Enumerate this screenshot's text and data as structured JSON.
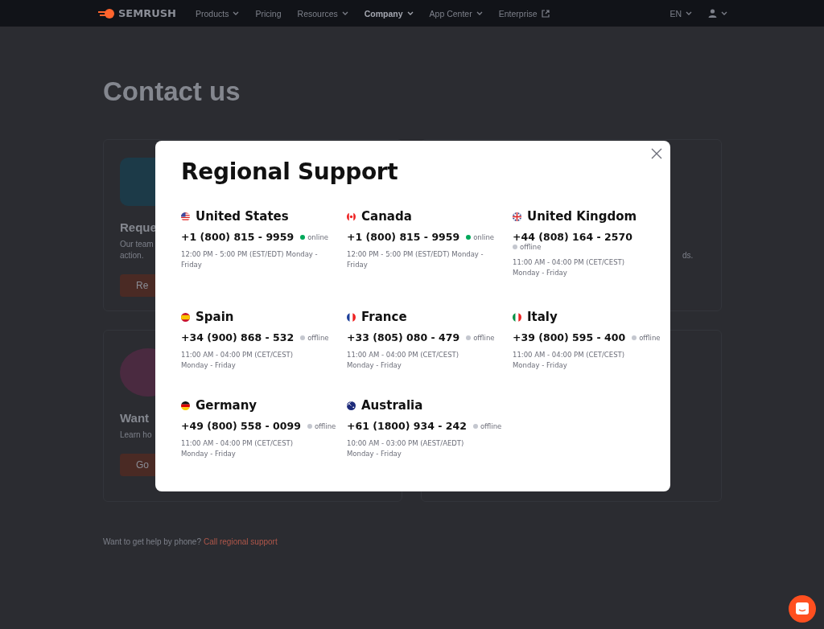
{
  "nav": {
    "logo": "SEMRUSH",
    "items": [
      {
        "label": "Products",
        "selected": false,
        "kind": "menu"
      },
      {
        "label": "Pricing",
        "selected": false,
        "kind": "link"
      },
      {
        "label": "Resources",
        "selected": false,
        "kind": "menu"
      },
      {
        "label": "Company",
        "selected": true,
        "kind": "menu"
      },
      {
        "label": "App Center",
        "selected": false,
        "kind": "menu"
      },
      {
        "label": "Enterprise",
        "selected": false,
        "kind": "external"
      }
    ],
    "language": "EN"
  },
  "page": {
    "title": "Contact us",
    "cards": [
      {
        "heading": "Reque",
        "text": [
          "Our team",
          "action."
        ],
        "button": "Re"
      },
      {
        "heading": "Want",
        "text": [
          "Learn ho"
        ],
        "button": "Go"
      }
    ],
    "right_text": "ds.",
    "phone_prompt": "Want to get help by phone?",
    "phone_link": "Call regional support"
  },
  "modal": {
    "title": "Regional Support",
    "regions": [
      {
        "country": "United States",
        "kind": "us",
        "phone": "+1 (800) 815 - 9959",
        "online": true,
        "status": "online",
        "hours": "12:00 PM - 5:00 PM (EST/EDT) Monday - Friday"
      },
      {
        "country": "Canada",
        "kind": "ca",
        "phone": "+1 (800) 815 - 9959",
        "online": true,
        "status": "online",
        "hours": "12:00 PM - 5:00 PM (EST/EDT) Monday - Friday"
      },
      {
        "country": "United Kingdom",
        "kind": "gb",
        "phone": "+44 (808) 164 - 2570",
        "online": false,
        "status": "offline",
        "hours": "11:00 AM - 04:00 PM (CET/CEST) Monday - Friday"
      },
      {
        "country": "Spain",
        "kind": "es",
        "phone": "+34 (900) 868 - 532",
        "online": false,
        "status": "offline",
        "hours": "11:00 AM - 04:00 PM (CET/CEST) Monday - Friday"
      },
      {
        "country": "France",
        "kind": "fr",
        "phone": "+33 (805) 080 - 479",
        "online": false,
        "status": "offline",
        "hours": "11:00 AM - 04:00 PM (CET/CEST) Monday - Friday"
      },
      {
        "country": "Italy",
        "kind": "it",
        "phone": "+39 (800) 595 - 400",
        "online": false,
        "status": "offline",
        "hours": "11:00 AM - 04:00 PM (CET/CEST) Monday - Friday"
      },
      {
        "country": "Germany",
        "kind": "de",
        "phone": "+49 (800) 558 - 0099",
        "online": false,
        "status": "offline",
        "hours": "11:00 AM - 04:00 PM (CET/CEST) Monday - Friday"
      },
      {
        "country": "Australia",
        "kind": "au",
        "phone": "+61 (1800) 934 - 242",
        "online": false,
        "status": "offline",
        "hours": "10:00 AM - 03:00 PM (AEST/AEDT) Monday - Friday"
      }
    ]
  }
}
